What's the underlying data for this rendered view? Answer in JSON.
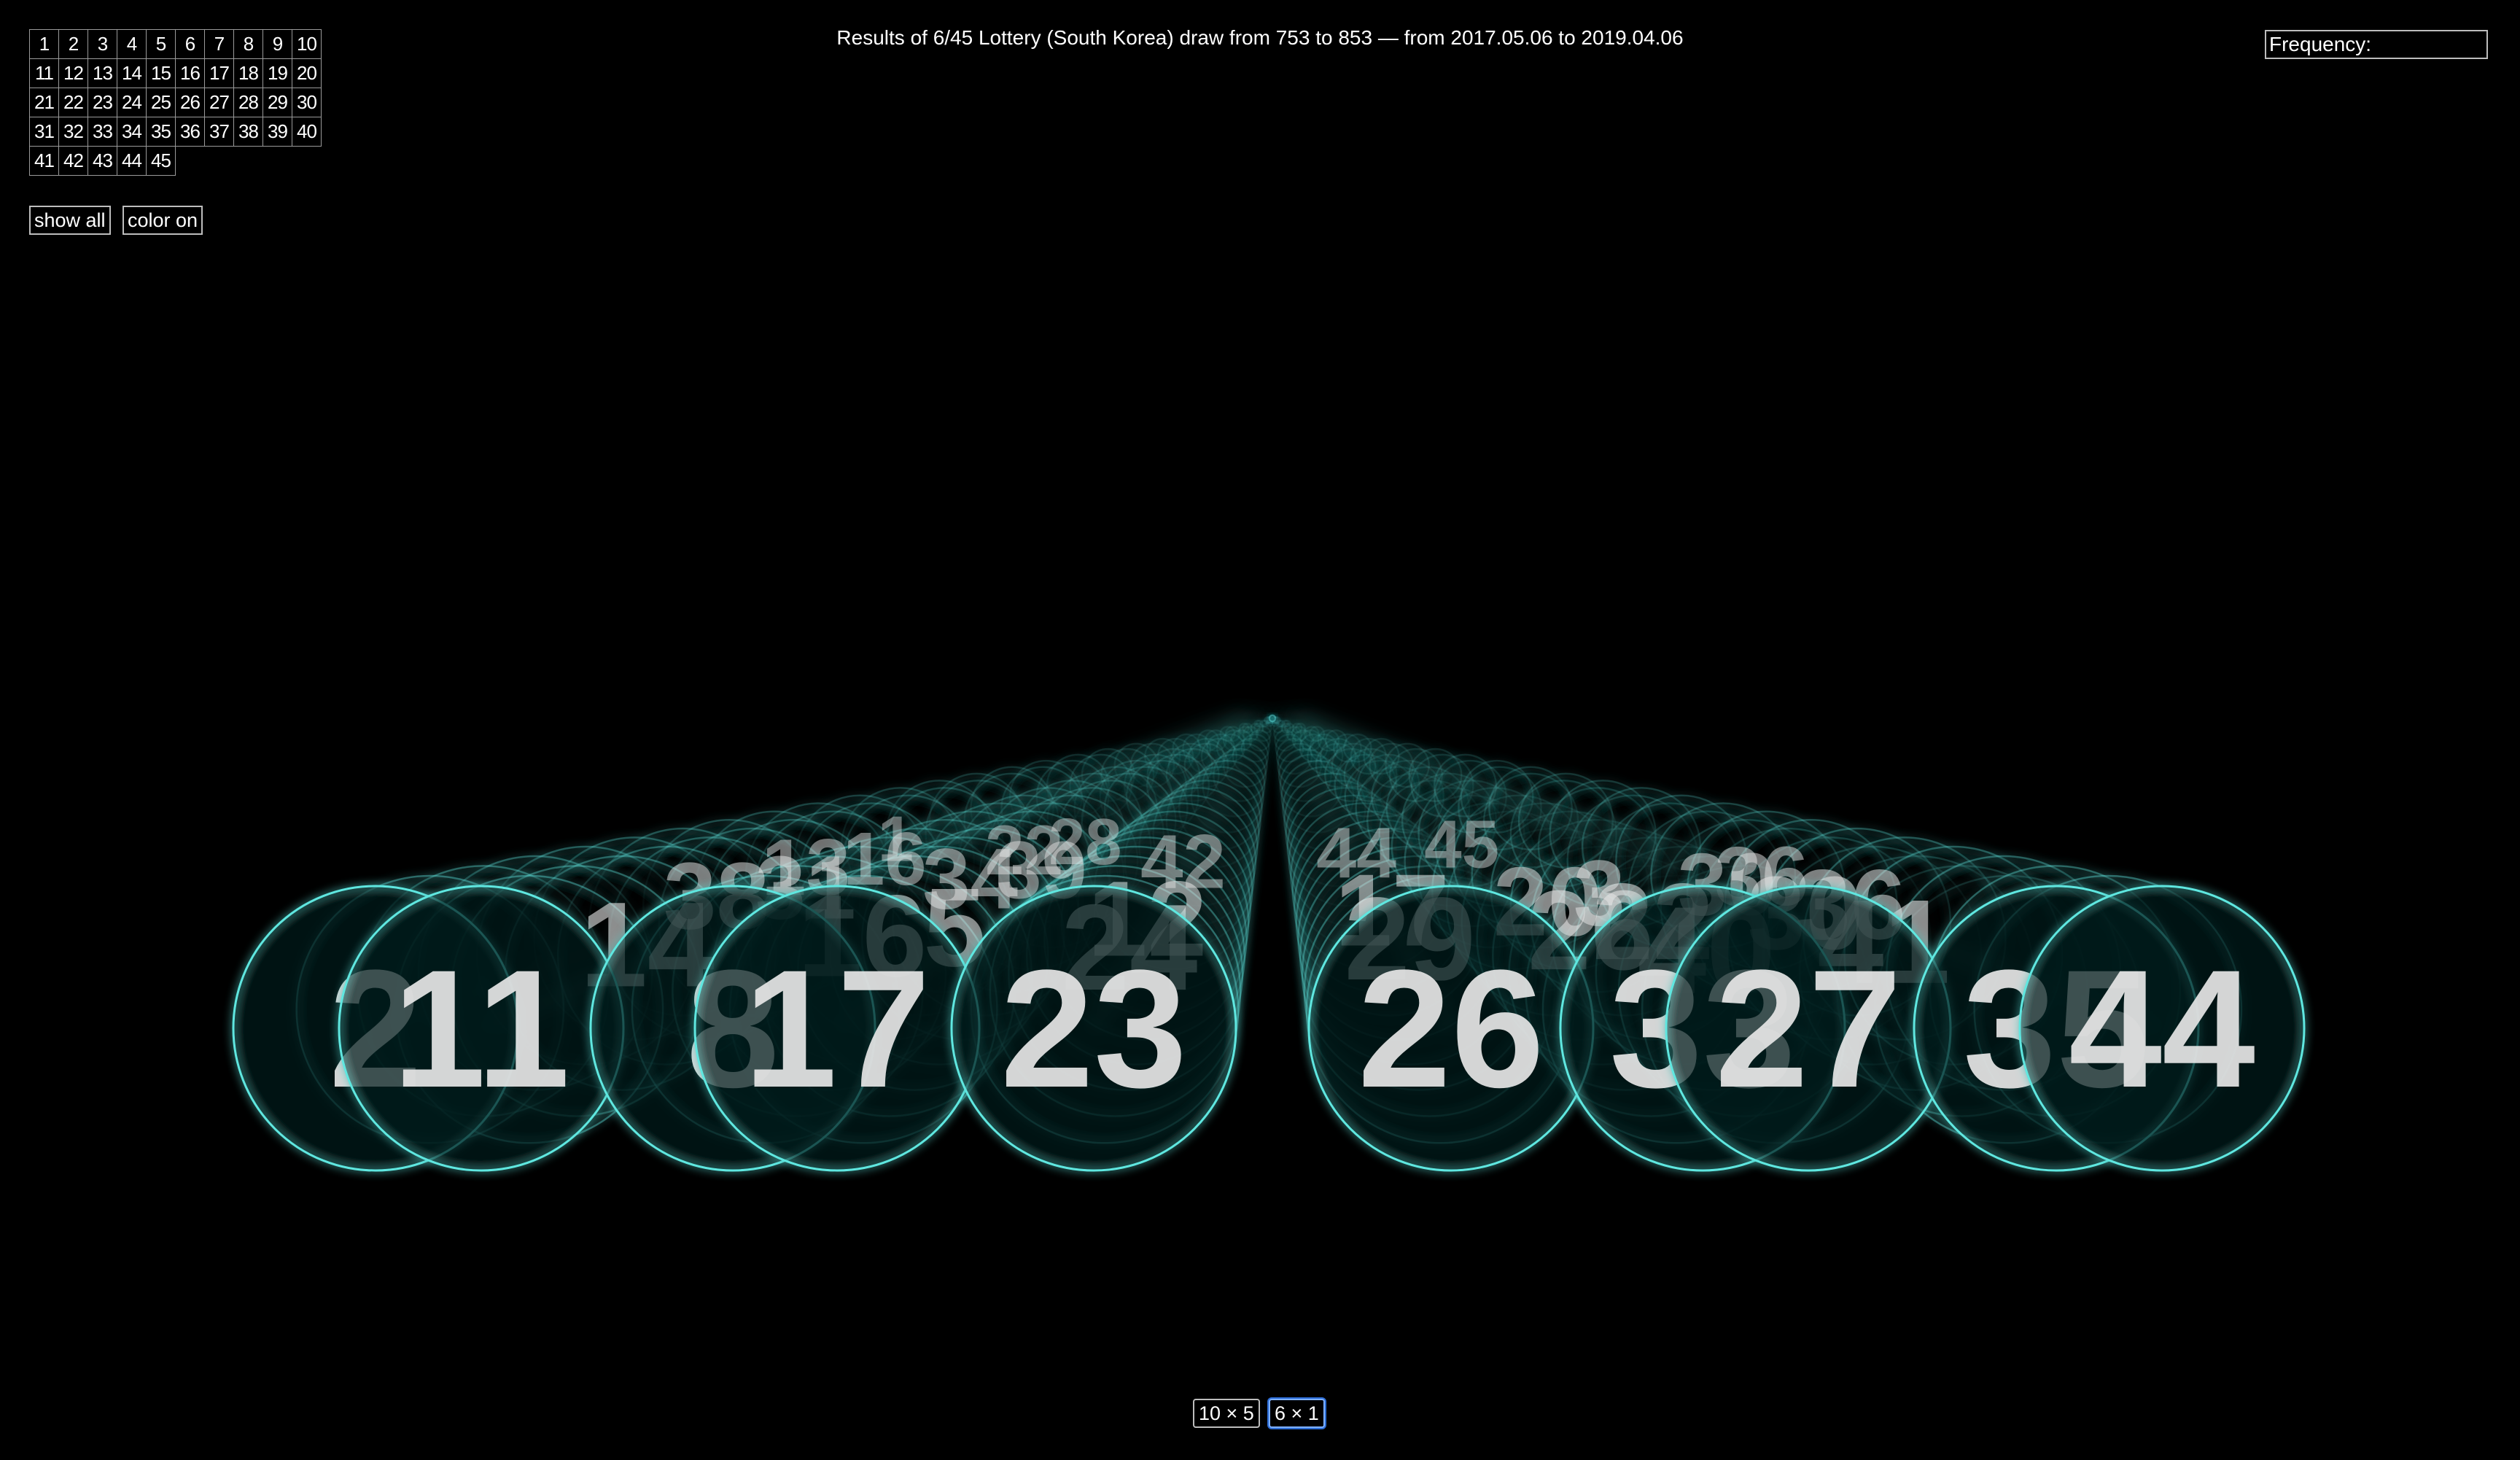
{
  "title": "Results of 6/45 Lottery (South Korea) draw from 753 to 853 — from 2017.05.06 to 2019.04.06",
  "number_grid": [
    "1",
    "2",
    "3",
    "4",
    "5",
    "6",
    "7",
    "8",
    "9",
    "10",
    "11",
    "12",
    "13",
    "14",
    "15",
    "16",
    "17",
    "18",
    "19",
    "20",
    "21",
    "22",
    "23",
    "24",
    "25",
    "26",
    "27",
    "28",
    "29",
    "30",
    "31",
    "32",
    "33",
    "34",
    "35",
    "36",
    "37",
    "38",
    "39",
    "40",
    "41",
    "42",
    "43",
    "44",
    "45"
  ],
  "controls": {
    "show_all": "show all",
    "color_on": "color on"
  },
  "frequency_label": "Frequency:",
  "layout_buttons": {
    "ten_by_five": "10 × 5",
    "six_by_one": "6 × 1",
    "selected": "6 × 1"
  },
  "colors": {
    "background": "#000000",
    "glow": "#5fe7e0",
    "ball_fill": "#0c1a1a",
    "number": "#e6e6e6"
  },
  "balls": {
    "front_row": [
      "2",
      "11",
      "8",
      "17",
      "23",
      "26",
      "33",
      "27",
      "35",
      "44"
    ],
    "trail_numbers": [
      "1",
      "14",
      "16",
      "5",
      "12",
      "17",
      "20",
      "3",
      "30",
      "36",
      "13",
      "16",
      "22",
      "28",
      "24",
      "29",
      "26",
      "22",
      "30",
      "36",
      "38",
      "31",
      "34",
      "39",
      "42",
      "44",
      "45",
      "40",
      "41"
    ]
  }
}
